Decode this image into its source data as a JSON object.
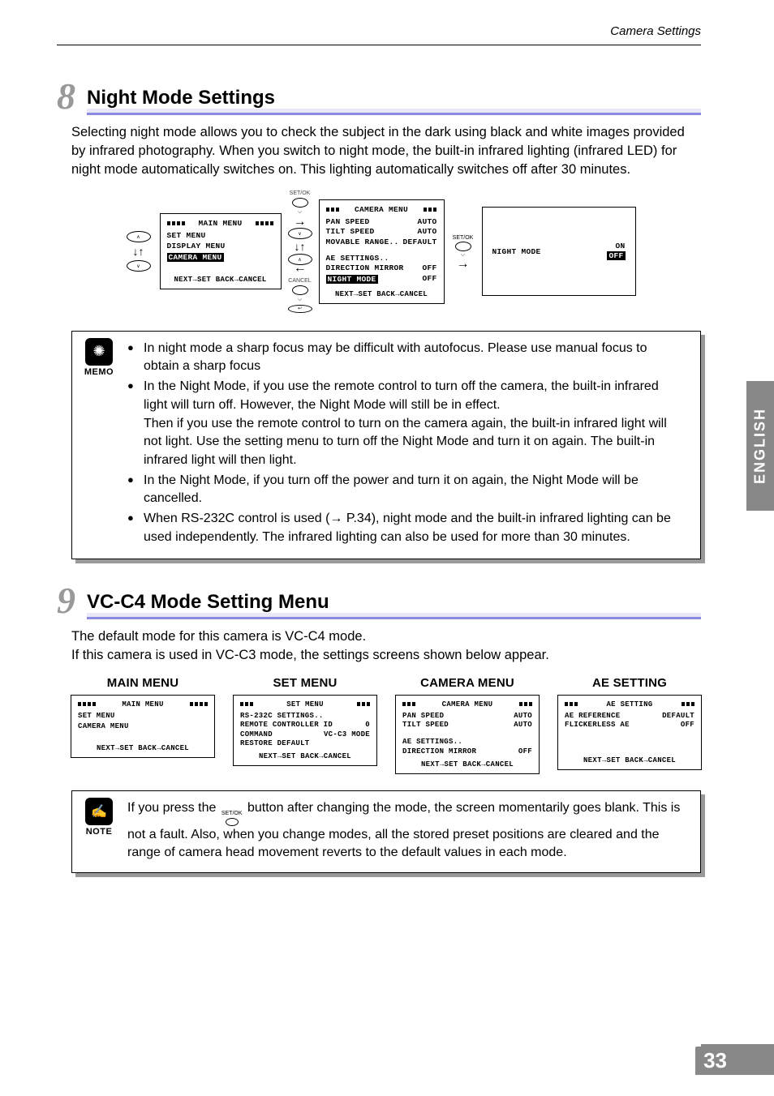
{
  "runningHead": "Camera Settings",
  "sideTab": "ENGLISH",
  "pageNumber": "33",
  "section8": {
    "num": "8",
    "title": "Night Mode Settings",
    "body": "Selecting night mode allows you to check the subject in the dark using black and white images provided by infrared photography. When you switch to night mode, the built-in infrared lighting (infrared LED) for night mode automatically switches on. This lighting automatically switches off after 30 minutes."
  },
  "flow": {
    "mainMenu": {
      "title": "MAIN  MENU",
      "lines": [
        "SET MENU",
        "DISPLAY MENU"
      ],
      "selected": "CAMERA MENU",
      "footer": "NEXT→SET  BACK→CANCEL"
    },
    "centerLabels": {
      "setok": "SET/OK",
      "cancel": "CANCEL"
    },
    "cameraMenu": {
      "title": "CAMERA MENU",
      "rows": [
        {
          "l": "PAN  SPEED",
          "r": "AUTO"
        },
        {
          "l": "TILT SPEED",
          "r": "AUTO"
        },
        {
          "l": "MOVABLE RANGE..",
          "r": "DEFAULT"
        }
      ],
      "gap": true,
      "rows2": [
        {
          "l": "AE SETTINGS..",
          "r": ""
        },
        {
          "l": "DIRECTION MIRROR",
          "r": "OFF"
        }
      ],
      "selected": {
        "l": "NIGHT MODE",
        "r": "OFF"
      },
      "footer": "NEXT→SET  BACK→CANCEL"
    },
    "setokLabel": "SET/OK",
    "nightMode": {
      "label": "NIGHT MODE",
      "on": "ON",
      "off": "OFF"
    }
  },
  "memo": {
    "label": "MEMO",
    "bullets": [
      "In night mode a sharp focus may be difficult with autofocus. Please use manual focus to obtain a sharp focus",
      "In the Night Mode, if you use the remote control to turn off the camera, the built-in infrared light will turn off. However, the Night Mode will still be in effect.",
      "Then if you use the remote control to turn on the camera again, the built-in infrared light will not light. Use the setting menu to turn off the Night Mode and turn it on again. The built-in infrared light will then light.",
      "In the Night Mode, if you turn off the power and turn it on again, the Night Mode will be cancelled.",
      "When RS-232C control is used (→ P.34), night mode and the built-in infrared lighting can be used independently. The infrared lighting can also be used for more than 30 minutes."
    ]
  },
  "section9": {
    "num": "9",
    "title": "VC-C4 Mode Setting Menu",
    "body1": "The default mode for this camera is VC-C4 mode.",
    "body2": "If this camera is used in VC-C3 mode, the settings screens shown below appear."
  },
  "menus": {
    "main": {
      "colTitle": "MAIN MENU",
      "title": "MAIN  MENU",
      "lines": [
        "SET MENU",
        "",
        "CAMERA MENU"
      ],
      "footer": "NEXT→SET  BACK→CANCEL"
    },
    "set": {
      "colTitle": "SET MENU",
      "title": "SET MENU",
      "rows": [
        {
          "l": "RS-232C SETTINGS..",
          "r": ""
        },
        {
          "l": "REMOTE CONTROLLER ID",
          "r": "0"
        },
        {
          "l": "COMMAND",
          "r": "VC-C3 MODE"
        },
        {
          "l": "RESTORE DEFAULT",
          "r": ""
        }
      ],
      "footer": "NEXT→SET  BACK→CANCEL"
    },
    "camera": {
      "colTitle": "CAMERA MENU",
      "title": "CAMERA MENU",
      "rows": [
        {
          "l": "PAN  SPEED",
          "r": "AUTO"
        },
        {
          "l": "TILT SPEED",
          "r": "AUTO"
        }
      ],
      "rows2": [
        {
          "l": "AE SETTINGS..",
          "r": ""
        },
        {
          "l": "DIRECTION MIRROR",
          "r": "OFF"
        }
      ],
      "footer": "NEXT→SET  BACK→CANCEL"
    },
    "ae": {
      "colTitle": "AE SETTING",
      "title": "AE SETTING",
      "rows": [
        {
          "l": "AE REFERENCE",
          "r": "DEFAULT"
        },
        {
          "l": "FLICKERLESS AE",
          "r": "OFF"
        }
      ],
      "footer": "NEXT→SET  BACK→CANCEL"
    }
  },
  "note": {
    "label": "NOTE",
    "pre": "If you press the ",
    "post": " button after changing the mode, the screen momentarily goes blank. This is not a fault. Also, when you change modes, all the stored preset positions are cleared and the range of camera head movement reverts to the default values in each mode.",
    "setok": "SET/OK"
  }
}
